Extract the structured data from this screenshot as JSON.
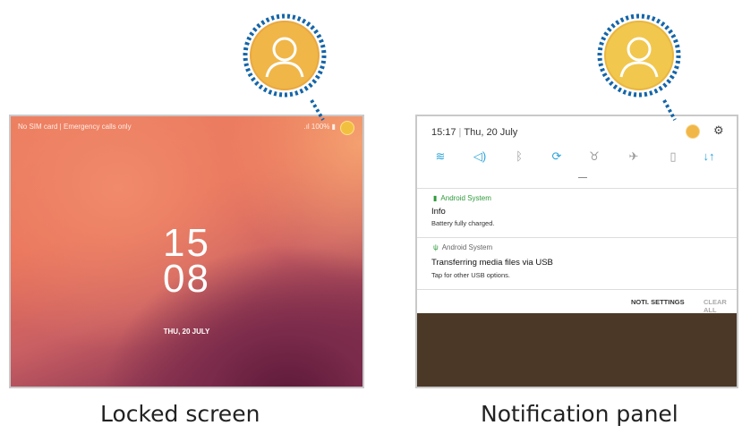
{
  "lock_screen": {
    "carrier": "No SIM card | Emergency calls only",
    "status": ".ıl 100% ▮",
    "clock_hours": "15",
    "clock_minutes": "08",
    "date": "THU, 20 JULY",
    "caption": "Locked screen"
  },
  "notification_panel": {
    "time": "15:17",
    "date": "Thu, 20 July",
    "quick_settings": [
      {
        "name": "wifi-icon",
        "glyph": "≋",
        "color": "#2aa3d8"
      },
      {
        "name": "sound-icon",
        "glyph": "◁)",
        "color": "#2aa3d8"
      },
      {
        "name": "bluetooth-icon",
        "glyph": "ᛒ",
        "color": "#9a9a9a"
      },
      {
        "name": "auto-rotate-icon",
        "glyph": "⟳",
        "color": "#2aa3d8"
      },
      {
        "name": "flashlight-icon",
        "glyph": "♉",
        "color": "#9a9a9a"
      },
      {
        "name": "airplane-mode-icon",
        "glyph": "✈",
        "color": "#9a9a9a"
      },
      {
        "name": "power-saving-icon",
        "glyph": "▯",
        "color": "#9a9a9a"
      },
      {
        "name": "mobile-data-icon",
        "glyph": "↓↑",
        "color": "#2aa3d8"
      }
    ],
    "notifications": [
      {
        "app": "Android System",
        "app_color": "#2e9a3a",
        "title": "Info",
        "text": "Battery fully charged."
      },
      {
        "app": "Android System",
        "app_color": "#666666",
        "title": "Transferring media files via USB",
        "text": "Tap for other USB options."
      }
    ],
    "noti_settings": "NOTI. SETTINGS",
    "clear_all": "CLEAR ALL",
    "caption": "Notification panel"
  },
  "colors": {
    "callout_border": "#1565a8",
    "callout_fill": "#f0b648"
  }
}
